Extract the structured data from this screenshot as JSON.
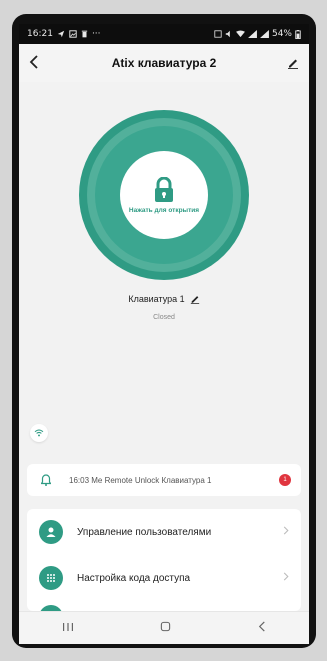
{
  "status_bar": {
    "time": "16:21",
    "battery": "54%"
  },
  "header": {
    "title": "Atix клавиатура 2"
  },
  "lock": {
    "unlock_label": "Нажать для открытия",
    "device_name": "Клавиатура 1",
    "state": "Closed"
  },
  "log": {
    "entry": "16:03 Me Remote Unlock Клавиатура 1",
    "badge_count": "1"
  },
  "menu": {
    "items": [
      {
        "label": "Управление пользователями",
        "icon": "user-icon"
      },
      {
        "label": "Настройка кода доступа",
        "icon": "keypad-icon"
      }
    ]
  },
  "colors": {
    "accent": "#2f9b84",
    "badge": "#e0353f"
  }
}
